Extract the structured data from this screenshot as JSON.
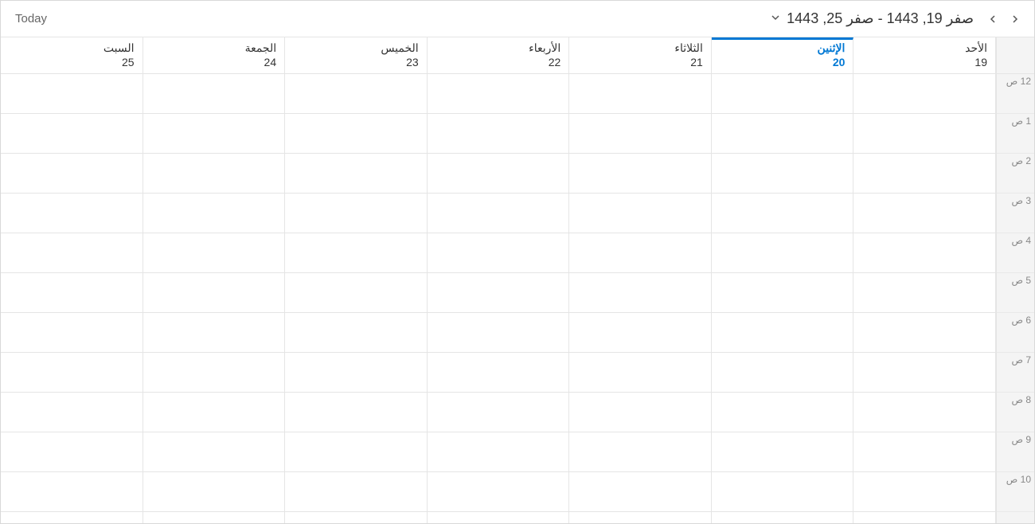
{
  "toolbar": {
    "today_label": "Today",
    "date_range": "صفر 19, 1443 - صفر 25, 1443"
  },
  "days": [
    {
      "name": "الأحد",
      "num": "19",
      "today": false
    },
    {
      "name": "الإثنين",
      "num": "20",
      "today": true
    },
    {
      "name": "الثلاثاء",
      "num": "21",
      "today": false
    },
    {
      "name": "الأربعاء",
      "num": "22",
      "today": false
    },
    {
      "name": "الخميس",
      "num": "23",
      "today": false
    },
    {
      "name": "الجمعة",
      "num": "24",
      "today": false
    },
    {
      "name": "السبت",
      "num": "25",
      "today": false
    }
  ],
  "time_slots": [
    "12 ص",
    "1 ص",
    "2 ص",
    "3 ص",
    "4 ص",
    "5 ص",
    "6 ص",
    "7 ص",
    "8 ص",
    "9 ص",
    "10 ص"
  ]
}
